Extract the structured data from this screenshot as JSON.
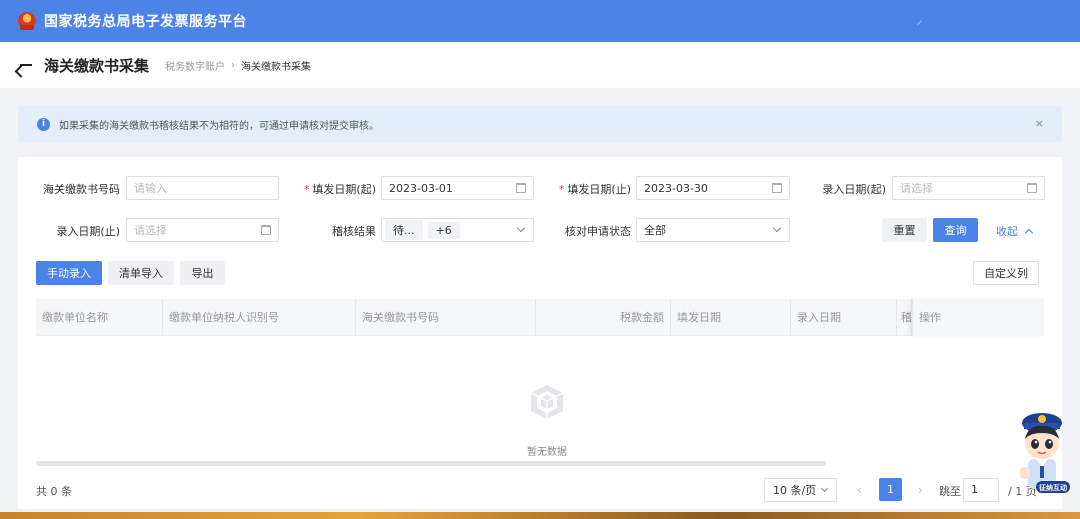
{
  "topbar": {
    "title": "国家税务总局电子发票服务平台",
    "tiny_glyph": "⸝"
  },
  "header": {
    "page_title": "海关缴款书采集",
    "breadcrumb": [
      "税务数字账户",
      "海关缴款书采集"
    ],
    "breadcrumb_sep": "›"
  },
  "alert": {
    "message": "如果采集的海关缴款书稽核结果不为相符的，可通过申请核对提交审核。",
    "close": "×"
  },
  "filters": {
    "customs_no": {
      "label": "海关缴款书号码",
      "placeholder": "请输入"
    },
    "issue_from": {
      "label": "填发日期(起)",
      "value": "2023-03-01",
      "required": true
    },
    "issue_to": {
      "label": "填发日期(止)",
      "value": "2023-03-30",
      "required": true
    },
    "entry_from": {
      "label": "录入日期(起)",
      "placeholder": "请选择"
    },
    "entry_to": {
      "label": "录入日期(止)",
      "placeholder": "请选择"
    },
    "audit_result": {
      "label": "稽核结果",
      "tag": "待...",
      "more": "+6"
    },
    "check_status": {
      "label": "核对申请状态",
      "value": "全部"
    },
    "reset": "重置",
    "query": "查询",
    "collapse": "收起",
    "required_mark": "*"
  },
  "toolbar": {
    "manual": "手动录入",
    "import": "清单导入",
    "export": "导出",
    "custom_cols": "自定义列"
  },
  "table": {
    "columns": [
      "缴款单位名称",
      "缴款单位纳税人识别号",
      "海关缴款书号码",
      "税款金额",
      "填发日期",
      "录入日期",
      "稽",
      "操作"
    ],
    "empty_text": "暂无数据"
  },
  "pagination": {
    "total": "共 0 条",
    "page_size": "10 条/页",
    "prev": "‹",
    "current": "1",
    "next": "›",
    "jump_label": "跳至",
    "jump_value": "1",
    "pages_text": "/ 1 页"
  },
  "mascot": {
    "badge": "征纳互动"
  },
  "colors": {
    "primary": "#4b84e6",
    "alert_bg": "#e3edfb",
    "required": "#e34"
  }
}
